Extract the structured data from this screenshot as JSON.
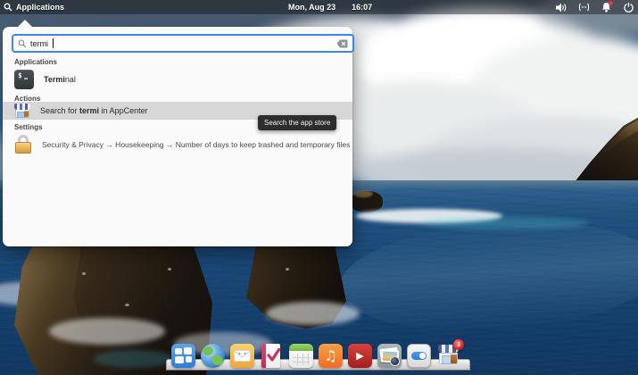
{
  "panel": {
    "applications_label": "Applications",
    "date": "Mon, Aug 23",
    "time": "16:07",
    "indicators": [
      "volume-icon",
      "network-icon",
      "notifications-icon",
      "power-icon"
    ],
    "notifications_has_alert": true
  },
  "launcher": {
    "search": {
      "value": "termi"
    },
    "sections": {
      "applications": {
        "header": "Applications",
        "terminal": {
          "match": "Termi",
          "rest": "nal"
        }
      },
      "actions": {
        "header": "Actions",
        "appcenter": {
          "prefix": "Search for ",
          "match": "termi",
          "suffix": " in AppCenter"
        }
      },
      "settings": {
        "header": "Settings",
        "housekeeping": "Security & Privacy → Housekeeping → Number of days to keep trashed and temporary files"
      }
    }
  },
  "tooltip": {
    "text": "Search the app store"
  },
  "dock": {
    "items": [
      "multitasking",
      "web-browser",
      "mail",
      "tasks",
      "calendar",
      "music",
      "videos",
      "photos",
      "system-settings",
      "appcenter"
    ],
    "appcenter_badge": "3"
  },
  "icons": {
    "terminal_glyph": "$",
    "music_glyph": "♫",
    "videos_glyph": "▶"
  },
  "colors": {
    "accent": "#3689e6",
    "selection": "#d7d7d7",
    "tooltip_bg": "#2d2d2d",
    "badge_red": "#d31c24"
  }
}
